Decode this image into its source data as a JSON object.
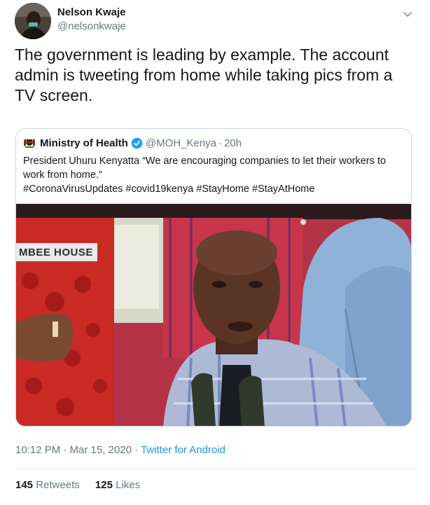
{
  "tweet": {
    "author": {
      "display_name": "Nelson Kwaje",
      "handle": "@nelsonkwaje"
    },
    "text": "The government is leading by example. The account admin is tweeting from home while taking pics from a TV screen.",
    "timestamp": "10:12 PM · Mar 15, 2020",
    "meta_separator": " · ",
    "source": "Twitter for Android",
    "stats": {
      "retweets_count": "145",
      "retweets_label": "Retweets",
      "likes_count": "125",
      "likes_label": "Likes"
    }
  },
  "quoted_tweet": {
    "display_name": "Ministry of Health",
    "handle": "@MOH_Kenya",
    "separator": "·",
    "time": "20h",
    "text_line_1": "President Uhuru Kenyatta “We are encouraging companies to let their workers to work from home.”",
    "hashtags": "#CoronaVirusUpdates #covid19kenya #StayHome #StayAtHome",
    "media_label": "MBEE HOUSE"
  },
  "icons": {
    "caret": "chevron-down-icon",
    "verified": "verified-badge-icon",
    "emblem": "coat-of-arms-icon"
  },
  "colors": {
    "link_blue": "#1b95e0",
    "secondary_text": "#657786",
    "verified_blue": "#1da1f2",
    "border": "#ccd6dd"
  }
}
